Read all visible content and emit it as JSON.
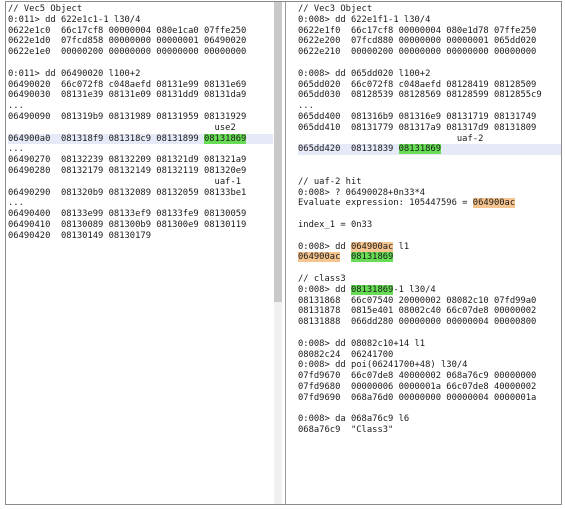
{
  "left": {
    "lines": [
      {
        "t": "// Vec5 Object"
      },
      {
        "t": "0:011> dd 622e1c1-1 l30/4"
      },
      {
        "t": "0622e1c0  66c17cf8 00000004 080e1ca0 07ffe250"
      },
      {
        "t": "0622e1d0  07fcd858 00000000 00000001 06490020"
      },
      {
        "t": "0622e1e0  00000200 00000000 00000000 00000000"
      },
      {
        "t": ""
      },
      {
        "t": "0:011> dd 06490020 l100+2"
      },
      {
        "t": "06490020  66c072f8 c048aefd 08131e99 08131e69"
      },
      {
        "t": "06490030  08131e39 08131e09 08131dd9 08131da9"
      },
      {
        "t": "..."
      },
      {
        "t": "06490090  081319b9 08131989 08131959 08131929"
      },
      {
        "t": "                                       use2"
      },
      {
        "t": "064900a0  081318f9 081318c9 08131899 ",
        "mark": "08131869",
        "color": "green",
        "hl": true
      },
      {
        "t": "..."
      },
      {
        "t": "06490270  08132239 08132209 081321d9 081321a9"
      },
      {
        "t": "06490280  08132179 08132149 08132119 081320e9"
      },
      {
        "t": "                                       uaf-1"
      },
      {
        "t": "06490290  081320b9 08132089 08132059 08133be1"
      },
      {
        "t": "..."
      },
      {
        "t": "06490400  08133e99 08133ef9 08133fe9 08130059"
      },
      {
        "t": "06490410  08130089 081300b9 081300e9 08130119"
      },
      {
        "t": "06490420  08130149 08130179"
      }
    ]
  },
  "right": {
    "lines": [
      {
        "t": "// Vec3 Object"
      },
      {
        "t": "0:008> dd 622e1f1-1 l30/4"
      },
      {
        "t": "0622e1f0  66c17cf8 00000004 080e1d78 07ffe250"
      },
      {
        "t": "0622e200  07fcd880 00000000 00000001 065dd020"
      },
      {
        "t": "0622e210  00000200 00000000 00000000 00000000"
      },
      {
        "t": ""
      },
      {
        "t": "0:008> dd 065dd020 l100+2"
      },
      {
        "t": "065dd020  66c072f8 c048aefd 08128419 08128509"
      },
      {
        "t": "065dd030  08128539 08128569 08128599 0812855c9"
      },
      {
        "t": "..."
      },
      {
        "t": "065dd400  081316b9 081316e9 08131719 08131749"
      },
      {
        "t": "065dd410  08131779 081317a9 081317d9 08131809"
      },
      {
        "t": "                              uaf-2"
      },
      {
        "t": "065dd420  08131839 ",
        "mark": "08131869",
        "color": "green",
        "hl": true
      },
      {
        "t": ""
      },
      {
        "t": ""
      },
      {
        "t": "// uaf-2 hit"
      },
      {
        "t": "0:008> ? 06490028+0n33*4"
      },
      {
        "t": "Evaluate expression: 105447596 = ",
        "mark": "064900ac",
        "color": "orange"
      },
      {
        "t": ""
      },
      {
        "t": "index_1 = 0n33"
      },
      {
        "t": ""
      },
      {
        "t": "0:008> dd ",
        "mark": "064900ac",
        "color": "orange",
        "after": " l1"
      },
      {
        "t": "",
        "mark": "064900ac",
        "color": "orange",
        "after": "  ",
        "mark2": "08131869",
        "color2": "green"
      },
      {
        "t": ""
      },
      {
        "t": "// class3"
      },
      {
        "t": "0:008> dd ",
        "mark": "08131869",
        "color": "green",
        "after": "-1 l30/4"
      },
      {
        "t": "08131868  66c07540 20000002 08082c10 07fd99a0"
      },
      {
        "t": "08131878  0815e401 08002c40 66c07de8 00000002"
      },
      {
        "t": "08131888  066dd280 00000000 00000004 00000800"
      },
      {
        "t": ""
      },
      {
        "t": "0:008> dd 08082c10+14 l1"
      },
      {
        "t": "08082c24  06241700"
      },
      {
        "t": "0:008> dd poi(06241700+48) l30/4"
      },
      {
        "t": "07fd9670  66c07de8 40000002 068a76c9 00000000"
      },
      {
        "t": "07fd9680  00000006 0000001a 66c07de8 40000002"
      },
      {
        "t": "07fd9690  068a76d0 00000000 00000004 0000001a"
      },
      {
        "t": ""
      },
      {
        "t": "0:008> da 068a76c9 l6"
      },
      {
        "t": "068a76c9  \"Class3\""
      }
    ]
  }
}
